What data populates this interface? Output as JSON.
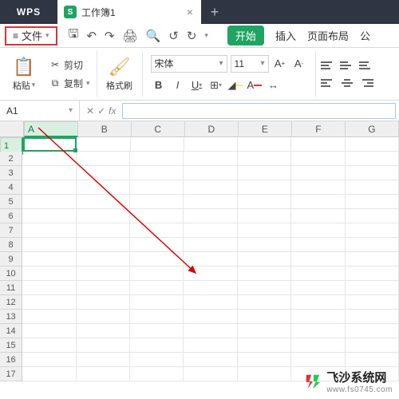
{
  "title": {
    "app": "WPS",
    "tab": "工作簿1"
  },
  "menu": {
    "file": "文件",
    "tabs": {
      "start": "开始",
      "insert": "插入",
      "layout": "页面布局",
      "formula": "公"
    }
  },
  "ribbon": {
    "paste": "粘贴",
    "cut": "剪切",
    "copy": "复制",
    "format_brush": "格式刷",
    "font_name": "宋体",
    "font_size": "11"
  },
  "cell": {
    "name": "A1",
    "fx_symbol": "fx"
  },
  "grid": {
    "cols": [
      "A",
      "B",
      "C",
      "D",
      "E",
      "F",
      "G"
    ],
    "rows": [
      "1",
      "2",
      "3",
      "4",
      "5",
      "6",
      "7",
      "8",
      "9",
      "10",
      "11",
      "12",
      "13",
      "14",
      "15",
      "16",
      "17"
    ]
  },
  "watermark": {
    "line1": "飞沙系统网",
    "line2": "www.fs0745.com"
  }
}
